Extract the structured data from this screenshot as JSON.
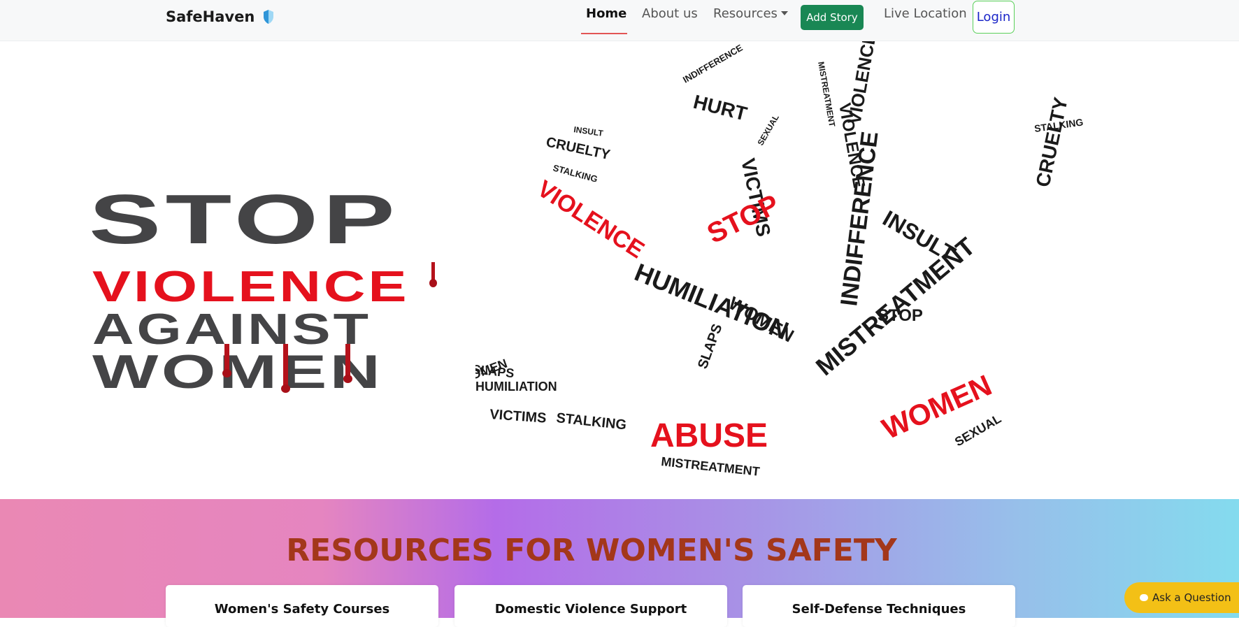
{
  "navbar": {
    "brand": "SafeHaven",
    "home": "Home",
    "about": "About us",
    "resources": "Resources",
    "add_story": "Add Story",
    "live_location": "Live Location",
    "login": "Login"
  },
  "hero": {
    "line1": "STOP",
    "line2": "VIOLENCE",
    "line3": "AGAINST",
    "line4": "WOMEN",
    "hand_words_large": [
      "VIOLENCE",
      "STOP",
      "HUMILIATION",
      "ABUSE",
      "WOMEN",
      "MISTREATMENT",
      "INDIFFERENCE",
      "INSULT",
      "CRUELTY",
      "VICTIMS",
      "HURT",
      "STALKING",
      "SLAPS",
      "SEXUAL"
    ]
  },
  "resources": {
    "title": "RESOURCES FOR WOMEN'S SAFETY",
    "cards": [
      {
        "title": "Women's Safety Courses"
      },
      {
        "title": "Domestic Violence Support"
      },
      {
        "title": "Self-Defense Techniques"
      }
    ]
  },
  "ask": {
    "label": "Ask a Question"
  },
  "colors": {
    "accent_red": "#e5111d",
    "dark_gray": "#444446",
    "green_button": "#198754",
    "title_brown": "#a3371a",
    "ask_yellow": "#f3c016"
  }
}
